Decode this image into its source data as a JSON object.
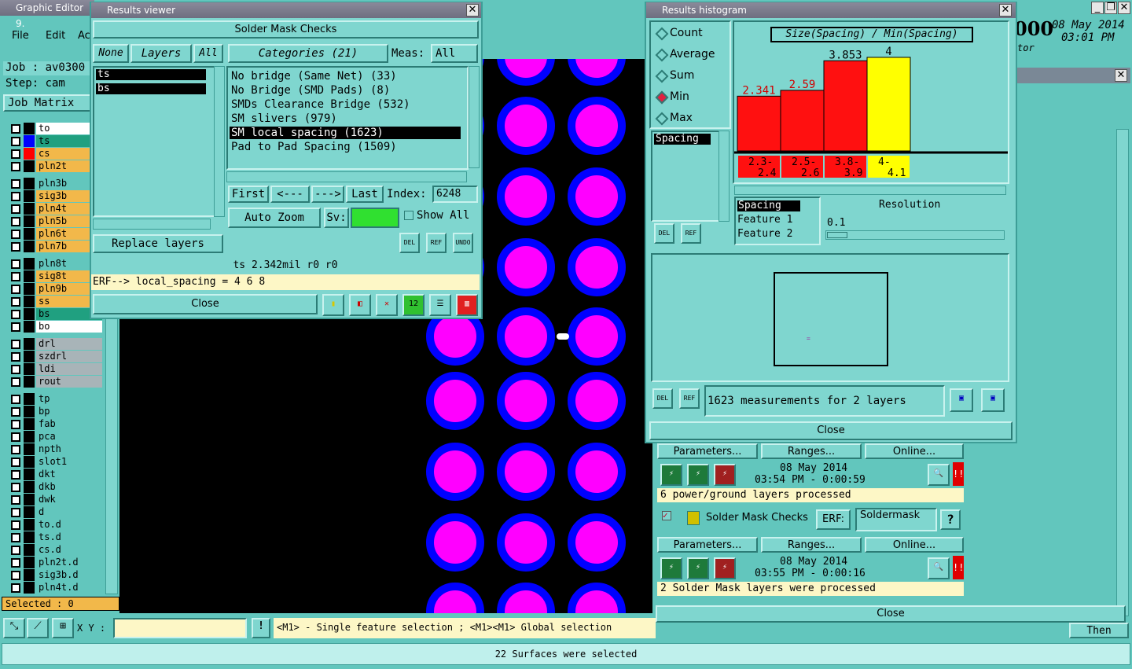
{
  "app": {
    "title": "Graphic Editor 9.",
    "menu": [
      "File",
      "Edit",
      "Ac"
    ],
    "job_label": "Job : av0300",
    "step_label": "Step: cam",
    "job_matrix": "Job Matrix",
    "date": "08 May 2014",
    "time": "03:01 PM",
    "num": "000",
    "tor": "tor",
    "then": "Then",
    "selected": "Selected : 0",
    "xy_label": "X Y :",
    "hint": "<M1> - Single feature selection ; <M1><M1> Global selection",
    "status": "22 Surfaces were selected"
  },
  "layers": [
    {
      "name": "to",
      "color": "#ffffff",
      "sw": "#000000"
    },
    {
      "name": "ts",
      "color": "#20a080",
      "sw": "#0000ff"
    },
    {
      "name": "cs",
      "color": "#f2b84a",
      "sw": "#ff0000"
    },
    {
      "name": "pln2t",
      "color": "#f2b84a",
      "sw": "#000000"
    },
    {
      "name": "pln3b",
      "color": "#62c6bd",
      "sw": "#000000"
    },
    {
      "name": "sig3b",
      "color": "#f2b84a",
      "sw": "#000000"
    },
    {
      "name": "pln4t",
      "color": "#f2b84a",
      "sw": "#000000"
    },
    {
      "name": "pln5b",
      "color": "#f2b84a",
      "sw": "#000000"
    },
    {
      "name": "pln6t",
      "color": "#f2b84a",
      "sw": "#000000"
    },
    {
      "name": "pln7b",
      "color": "#f2b84a",
      "sw": "#000000"
    },
    {
      "name": "pln8t",
      "color": "#62c6bd",
      "sw": "#000000"
    },
    {
      "name": "sig8t",
      "color": "#f2b84a",
      "sw": "#000000"
    },
    {
      "name": "pln9b",
      "color": "#f2b84a",
      "sw": "#000000"
    },
    {
      "name": "ss",
      "color": "#f2b84a",
      "sw": "#000000"
    },
    {
      "name": "bs",
      "color": "#20a080",
      "sw": "#000000"
    },
    {
      "name": "bo",
      "color": "#ffffff",
      "sw": "#000000"
    },
    {
      "name": "drl",
      "color": "#a8b4b8",
      "sw": "#000000"
    },
    {
      "name": "szdrl",
      "color": "#a8b4b8",
      "sw": "#000000"
    },
    {
      "name": "ldi",
      "color": "#a8b4b8",
      "sw": "#000000"
    },
    {
      "name": "rout",
      "color": "#a8b4b8",
      "sw": "#000000"
    },
    {
      "name": "tp",
      "color": "#62c6bd",
      "sw": "#000000"
    },
    {
      "name": "bp",
      "color": "#62c6bd",
      "sw": "#000000"
    },
    {
      "name": "fab",
      "color": "#62c6bd",
      "sw": "#000000"
    },
    {
      "name": "pca",
      "color": "#62c6bd",
      "sw": "#000000"
    },
    {
      "name": "npth",
      "color": "#62c6bd",
      "sw": "#000000"
    },
    {
      "name": "slot1",
      "color": "#62c6bd",
      "sw": "#000000"
    },
    {
      "name": "dkt",
      "color": "#62c6bd",
      "sw": "#000000"
    },
    {
      "name": "dkb",
      "color": "#62c6bd",
      "sw": "#000000"
    },
    {
      "name": "dwk",
      "color": "#62c6bd",
      "sw": "#000000"
    },
    {
      "name": "d",
      "color": "#62c6bd",
      "sw": "#000000"
    },
    {
      "name": "to.d",
      "color": "#62c6bd",
      "sw": "#000000"
    },
    {
      "name": "ts.d",
      "color": "#62c6bd",
      "sw": "#000000"
    },
    {
      "name": "cs.d",
      "color": "#62c6bd",
      "sw": "#000000"
    },
    {
      "name": "pln2t.d",
      "color": "#62c6bd",
      "sw": "#000000"
    },
    {
      "name": "sig3b.d",
      "color": "#62c6bd",
      "sw": "#000000"
    },
    {
      "name": "pln4t.d",
      "color": "#62c6bd",
      "sw": "#000000"
    }
  ],
  "viewer": {
    "title": "Results viewer",
    "header": "Solder Mask Checks",
    "tab_none": "None",
    "tab_layers": "Layers",
    "tab_all": "All",
    "categories_btn": "Categories (21)",
    "meas_label": "Meas:",
    "meas_value": "All",
    "layer_list": [
      "ts",
      "bs"
    ],
    "categories": [
      "No bridge (Same Net) (33)",
      "No Bridge (SMD Pads) (8)",
      "SMDs Clearance Bridge (532)",
      "SM slivers (979)",
      "SM local spacing (1623)",
      "Pad to Pad Spacing (1509)"
    ],
    "first": "First",
    "prev": "<---",
    "next": "--->",
    "last": "Last",
    "index_label": "Index:",
    "index_value": "6248",
    "auto_zoom": "Auto Zoom",
    "sv": "Sv:",
    "show_all": "Show All",
    "replace": "Replace layers",
    "info": "ts 2.342mil  r0  r0",
    "erf": "ERF--> local_spacing = 4 6 8",
    "close": "Close",
    "del": "DEL",
    "ref": "REF",
    "undo": "UNDO"
  },
  "hist": {
    "title": "Results histogram",
    "options": [
      "Count",
      "Average",
      "Sum",
      "Min",
      "Max"
    ],
    "selected_option": "Min",
    "formula": "Size(Spacing) / Min(Spacing)",
    "list": [
      "Spacing"
    ],
    "props": [
      "Spacing",
      "Feature 1",
      "Feature 2"
    ],
    "res_label": "Resolution",
    "res_value": "0.1",
    "summary": "1623 measurements for 2 layers",
    "close": "Close",
    "del": "DEL",
    "ref": "REF"
  },
  "chart_data": {
    "type": "bar",
    "categories": [
      "2.3-2.4",
      "2.5-2.6",
      "3.8-3.9",
      "4-4.1"
    ],
    "values": [
      2.341,
      2.59,
      3.853,
      4
    ],
    "value_labels": [
      "2.341",
      "2.59",
      "3.853",
      "4"
    ],
    "colors": [
      "#ff1010",
      "#ff1010",
      "#ff1010",
      "#ffff00"
    ],
    "label_colors": [
      "#d00000",
      "#d00000",
      "#000000",
      "#000000"
    ],
    "ylim": [
      0,
      4.3
    ]
  },
  "checks": {
    "params": "Parameters...",
    "ranges": "Ranges...",
    "online": "Online...",
    "date1": "08 May 2014",
    "time1": "03:54 PM - 0:00:59",
    "msg1": "6 power/ground layers processed",
    "sm_title": "Solder Mask Checks",
    "erf_label": "ERF:",
    "erf_value": "Soldermask",
    "q": "?",
    "date2": "08 May 2014",
    "time2": "03:55 PM - 0:00:16",
    "msg2": "2 Solder Mask layers were processed",
    "close": "Close"
  }
}
